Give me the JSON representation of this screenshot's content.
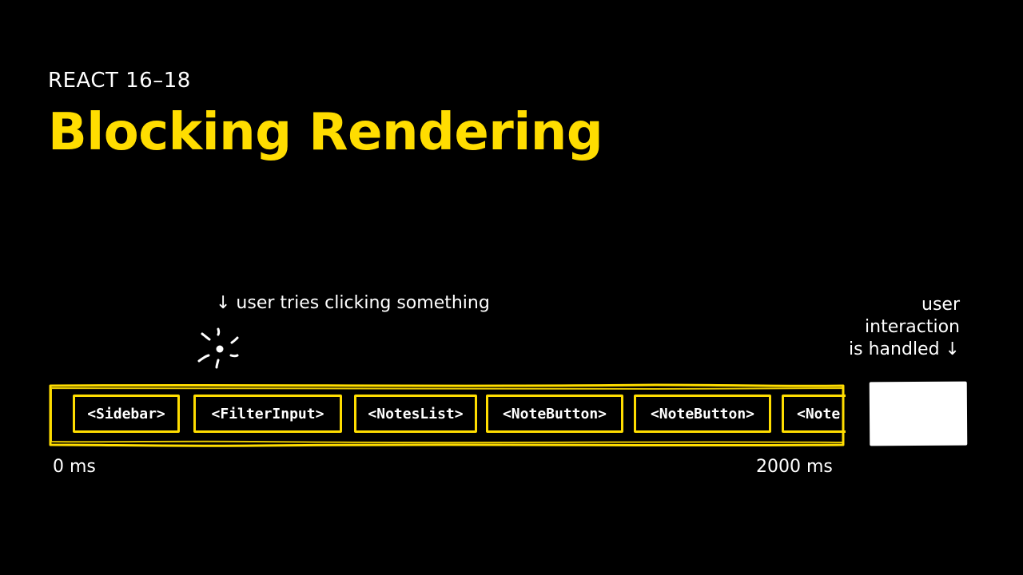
{
  "eyebrow": "REACT 16–18",
  "title": "Blocking Rendering",
  "annotations": {
    "user_click": "↓ user tries clicking something",
    "handled": {
      "line1": "user",
      "line2": "interaction",
      "line3": "is handled ↓"
    }
  },
  "timeline": {
    "components": [
      "<Sidebar>",
      "<FilterInput>",
      "<NotesList>",
      "<NoteButton>",
      "<NoteButton>",
      "<Note"
    ],
    "ticks": {
      "start": "0 ms",
      "end": "2000 ms"
    }
  },
  "colors": {
    "background": "#000000",
    "accent": "#ffdd00",
    "text": "#ffffff"
  },
  "icons": {
    "click_burst": "click-burst-icon"
  }
}
